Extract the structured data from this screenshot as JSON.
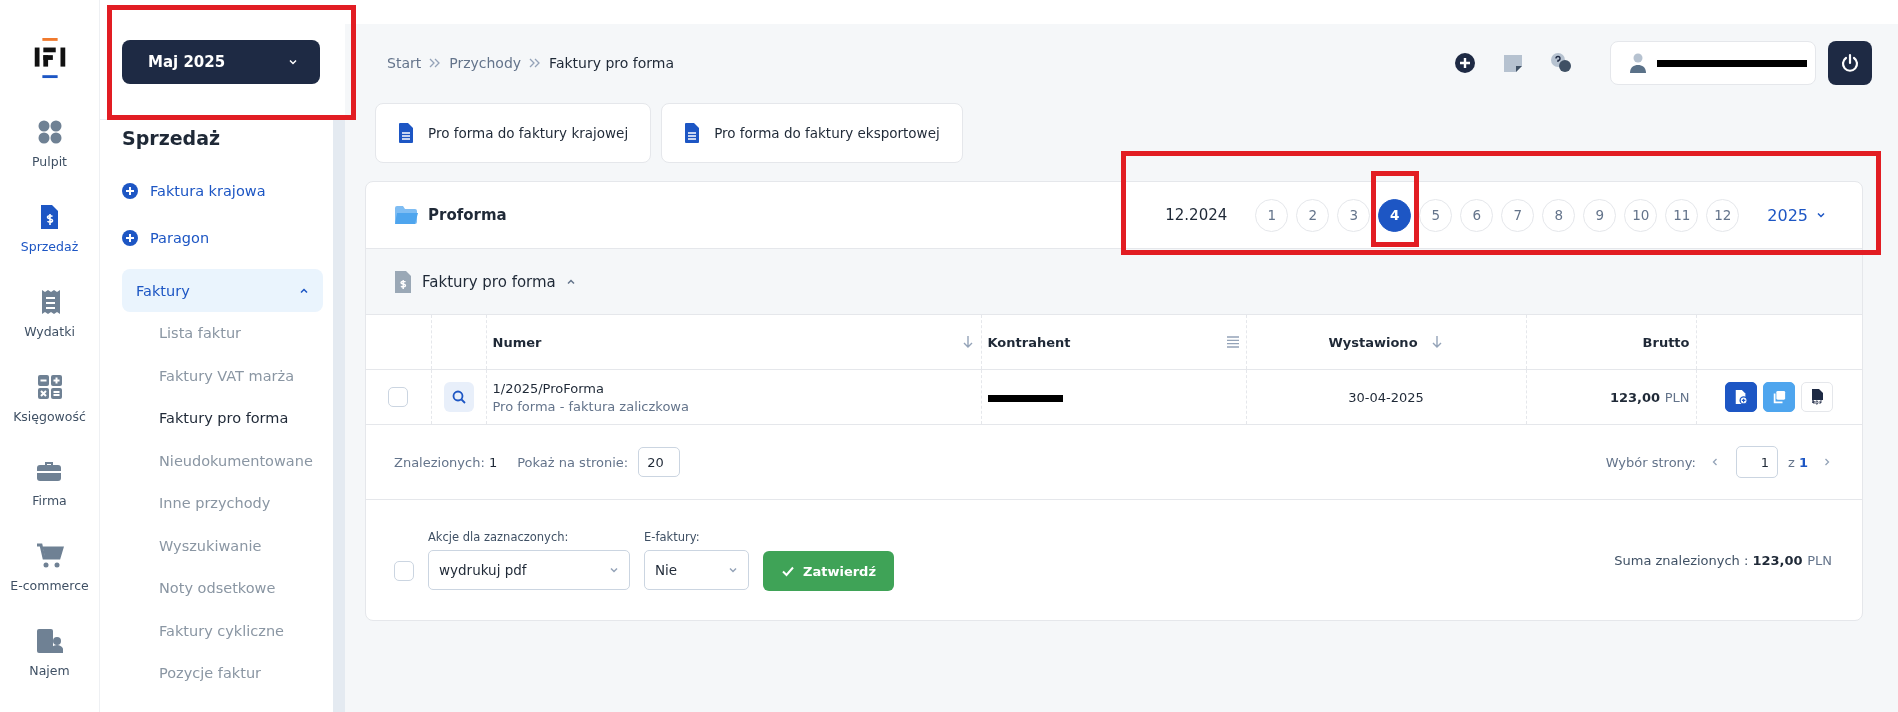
{
  "rail": [
    {
      "label": "Pulpit",
      "selected": false
    },
    {
      "label": "Sprzedaż",
      "selected": true
    },
    {
      "label": "Wydatki",
      "selected": false
    },
    {
      "label": "Księgowość",
      "selected": false
    },
    {
      "label": "Firma",
      "selected": false
    },
    {
      "label": "E-commerce",
      "selected": false
    },
    {
      "label": "Najem",
      "selected": false
    }
  ],
  "month_picker": {
    "value": "Maj 2025",
    "highlighted": true
  },
  "sidebar": {
    "title": "Sprzedaż",
    "actions": [
      "Faktura krajowa",
      "Paragon"
    ],
    "group": {
      "label": "Faktury",
      "expanded": true,
      "items": [
        {
          "label": "Lista faktur",
          "selected": false
        },
        {
          "label": "Faktury VAT marża",
          "selected": false
        },
        {
          "label": "Faktury pro forma",
          "selected": true
        },
        {
          "label": "Nieudokumentowane",
          "selected": false
        },
        {
          "label": "Inne przychody",
          "selected": false
        },
        {
          "label": "Wyszukiwanie",
          "selected": false
        },
        {
          "label": "Noty odsetkowe",
          "selected": false
        },
        {
          "label": "Faktury cykliczne",
          "selected": false
        },
        {
          "label": "Pozycje faktur",
          "selected": false
        }
      ]
    }
  },
  "breadcrumb": [
    "Start",
    "Przychody",
    "Faktury pro forma"
  ],
  "user": {
    "redacted": true
  },
  "new_buttons": [
    "Pro forma do faktury krajowej",
    "Pro forma do faktury eksportowej"
  ],
  "card": {
    "title": "Proforma",
    "month_bar": {
      "highlighted": true,
      "previous": "12.2024",
      "months": [
        {
          "label": "1",
          "selected": false,
          "highlighted": false
        },
        {
          "label": "2",
          "selected": false,
          "highlighted": false
        },
        {
          "label": "3",
          "selected": false,
          "highlighted": false
        },
        {
          "label": "4",
          "selected": true,
          "highlighted": true
        },
        {
          "label": "5",
          "selected": false,
          "highlighted": false
        },
        {
          "label": "6",
          "selected": false,
          "highlighted": false
        },
        {
          "label": "7",
          "selected": false,
          "highlighted": false
        },
        {
          "label": "8",
          "selected": false,
          "highlighted": false
        },
        {
          "label": "9",
          "selected": false,
          "highlighted": false
        },
        {
          "label": "10",
          "selected": false,
          "highlighted": false
        },
        {
          "label": "11",
          "selected": false,
          "highlighted": false
        },
        {
          "label": "12",
          "selected": false,
          "highlighted": false
        }
      ],
      "year": "2025"
    },
    "section": {
      "title": "Faktury pro forma",
      "expanded": true
    },
    "columns": [
      "Numer",
      "Kontrahent",
      "Wystawiono",
      "Brutto"
    ],
    "rows": [
      {
        "checked": false,
        "number": "1/2025/ProForma",
        "description": "Pro forma - faktura zaliczkowa",
        "contractor_redacted": true,
        "issued": "30-04-2025",
        "amount": "123,00",
        "currency": "PLN"
      }
    ],
    "found_label": "Znalezionych:",
    "found": "1",
    "per_page_label": "Pokaż na stronie:",
    "per_page": "20",
    "page_label": "Wybór strony:",
    "page": "1",
    "of_label": "z",
    "pages": "1",
    "bulk": {
      "checked": false,
      "actions_label": "Akcje dla zaznaczonych:",
      "action": "wydrukuj pdf",
      "efaktury_label": "E-faktury:",
      "efaktury": "Nie",
      "submit": "Zatwierdź"
    },
    "sum_label": "Suma znalezionych :",
    "sum": "123,00",
    "sum_currency": "PLN"
  }
}
